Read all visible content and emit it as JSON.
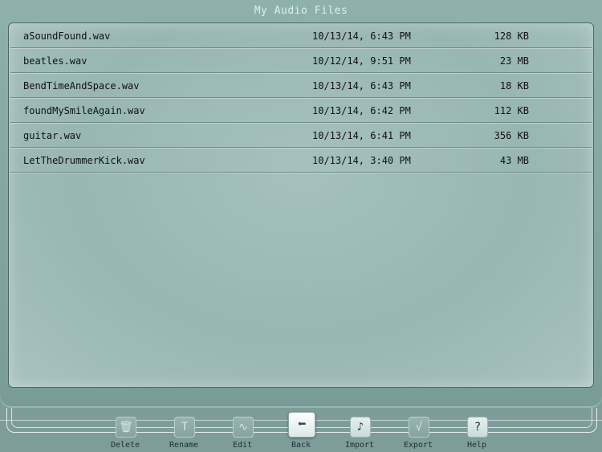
{
  "header": {
    "title": "My Audio Files"
  },
  "files": [
    {
      "name": "aSoundFound.wav",
      "date": "10/13/14, 6:43 PM",
      "size": "128 KB"
    },
    {
      "name": "beatles.wav",
      "date": "10/12/14, 9:51 PM",
      "size": "23 MB"
    },
    {
      "name": "BendTimeAndSpace.wav",
      "date": "10/13/14, 6:43 PM",
      "size": "18 KB"
    },
    {
      "name": "foundMySmileAgain.wav",
      "date": "10/13/14, 6:42 PM",
      "size": "112 KB"
    },
    {
      "name": "guitar.wav",
      "date": "10/13/14, 6:41 PM",
      "size": "356 KB"
    },
    {
      "name": "LetTheDrummerKick.wav",
      "date": "10/13/14, 3:40 PM",
      "size": "43 MB"
    }
  ],
  "toolbar": {
    "delete": {
      "label": "Delete",
      "icon": "trash-icon",
      "glyph": "🗑"
    },
    "rename": {
      "label": "Rename",
      "icon": "text-icon",
      "glyph": "T"
    },
    "edit": {
      "label": "Edit",
      "icon": "waveform-icon",
      "glyph": "∿"
    },
    "back": {
      "label": "Back",
      "icon": "arrow-left-icon",
      "glyph": "⬅"
    },
    "import": {
      "label": "Import",
      "icon": "music-note-icon",
      "glyph": "♪"
    },
    "export": {
      "label": "Export",
      "icon": "export-icon",
      "glyph": "√"
    },
    "help": {
      "label": "Help",
      "icon": "question-icon",
      "glyph": "?"
    }
  },
  "colors": {
    "background": "#7e9d9a",
    "panel": "#a6c1bd",
    "active_button": "#ffffff"
  }
}
